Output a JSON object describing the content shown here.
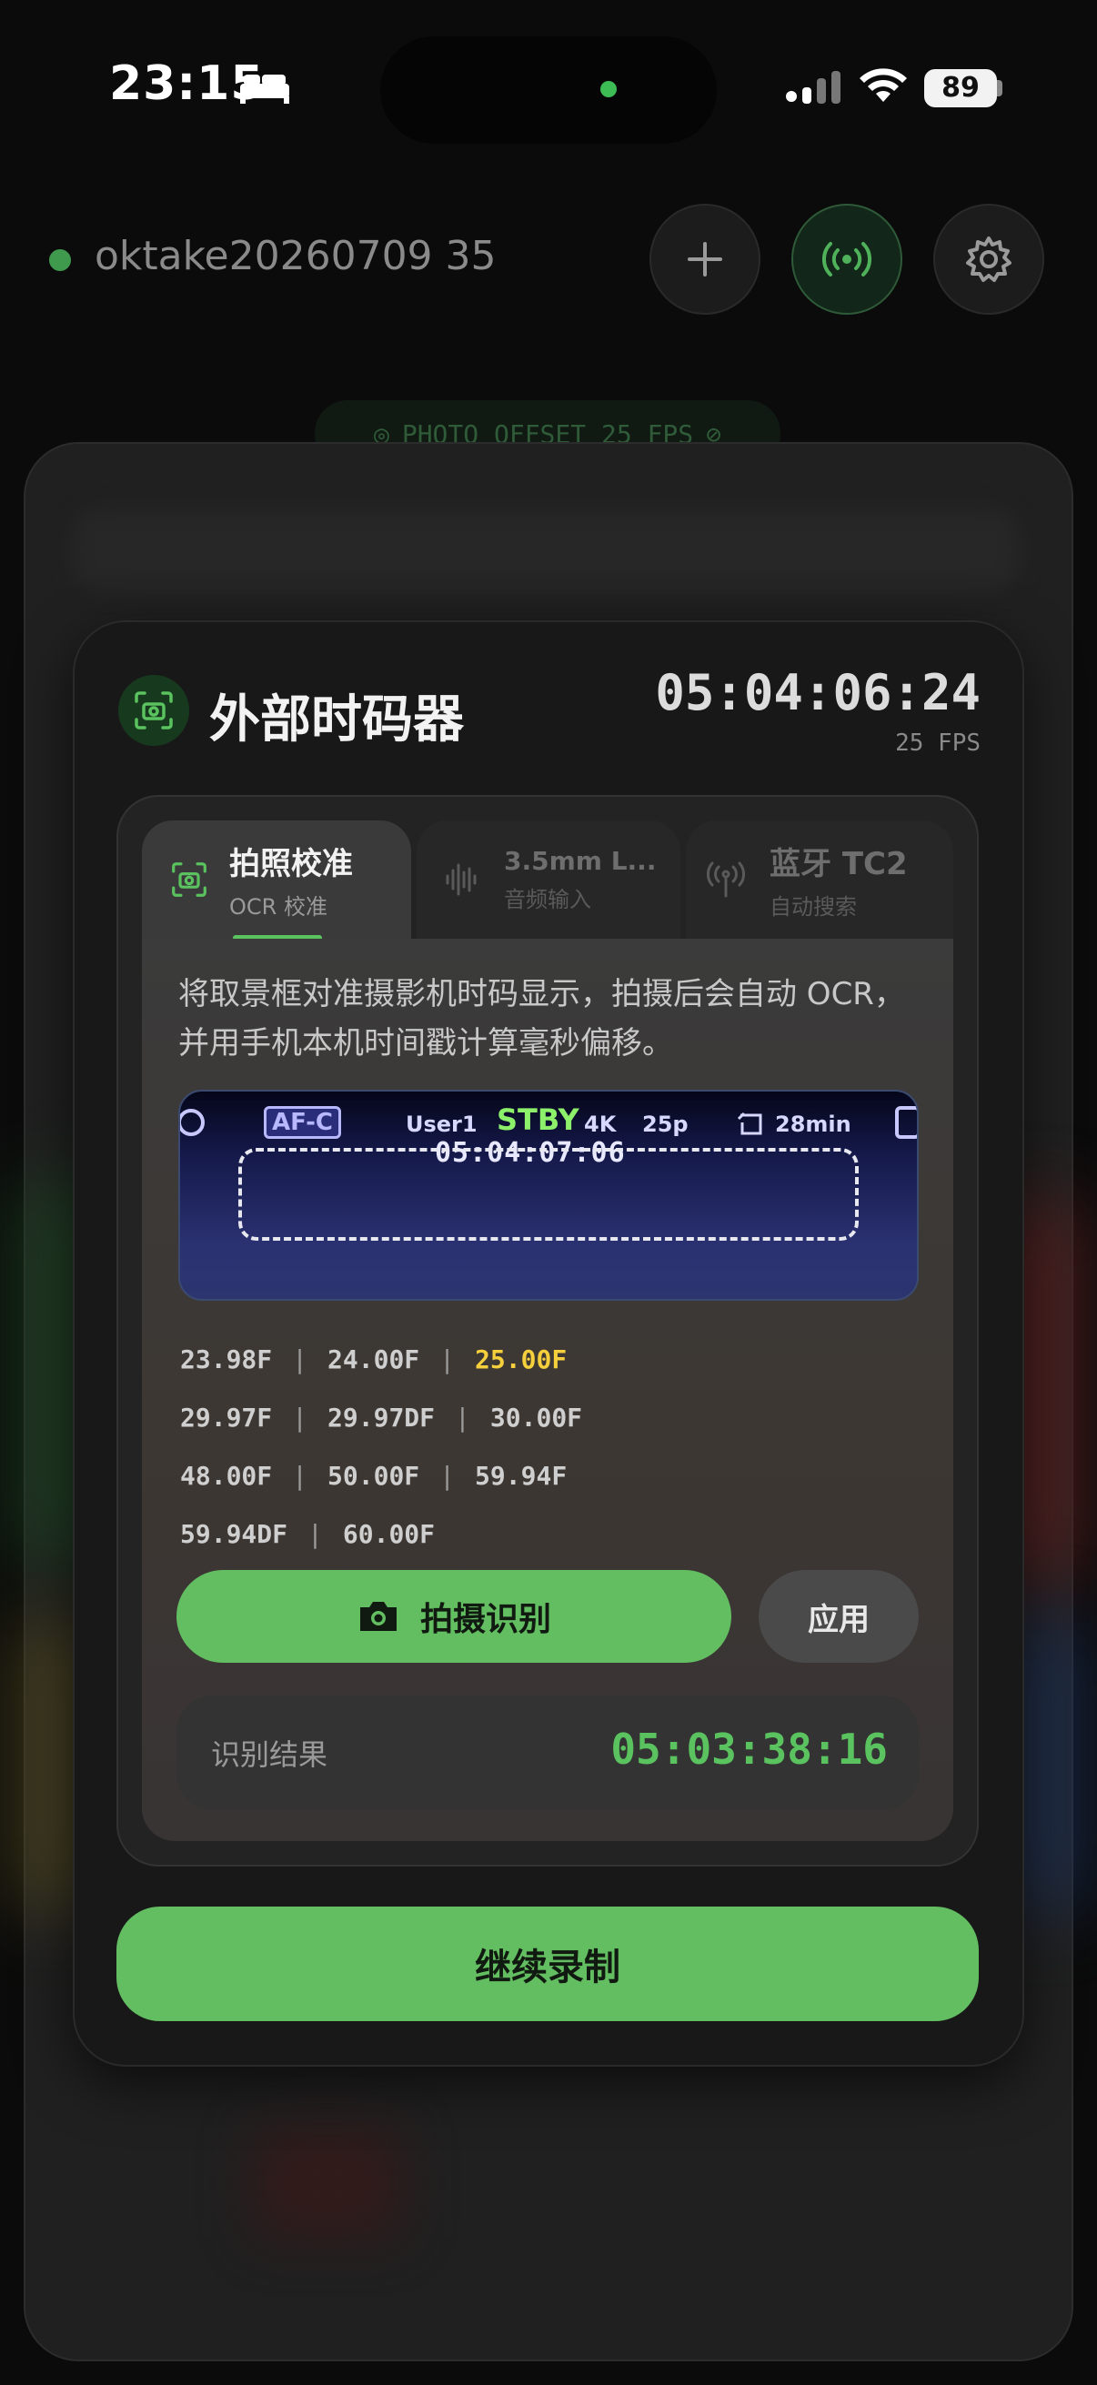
{
  "status": {
    "time": "23:15",
    "battery": "89"
  },
  "header": {
    "session_name": "oktake20260709 35"
  },
  "offset_pill": {
    "label": "PHOTO OFFSET 25 FPS"
  },
  "card": {
    "title": "外部时码器",
    "timecode": "05:04:06:24",
    "fps": "25 FPS"
  },
  "tabs": [
    {
      "label": "拍照校准",
      "sub": "OCR 校准",
      "active": true
    },
    {
      "label": "3.5mm L...",
      "sub": "音频输入",
      "active": false
    },
    {
      "label": "蓝牙 TC2",
      "sub": "自动搜索",
      "active": false
    }
  ],
  "content": {
    "description": "将取景框对准摄影机时码显示，拍摄后会自动 OCR，并用手机本机时间戳计算毫秒偏移。",
    "preview": {
      "af": "AF-C",
      "user": "User1",
      "stby": "STBY",
      "res": "4K",
      "rate": "25p",
      "remain": "28min",
      "timecode": "05:04:07:06"
    },
    "fps_rows": [
      [
        "23.98F",
        "24.00F",
        "25.00F"
      ],
      [
        "29.97F",
        "29.97DF",
        "30.00F"
      ],
      [
        "48.00F",
        "50.00F",
        "59.94F"
      ],
      [
        "59.94DF",
        "60.00F"
      ]
    ],
    "fps_active": "25.00F",
    "capture_label": "拍摄识别",
    "apply_label": "应用",
    "result_label": "识别结果",
    "result_value": "05:03:38:16"
  },
  "continue_label": "继续录制",
  "colors": {
    "accent_green": "#63bd61",
    "active_fps": "#f5cf3c",
    "result_green": "#5ac35f"
  }
}
